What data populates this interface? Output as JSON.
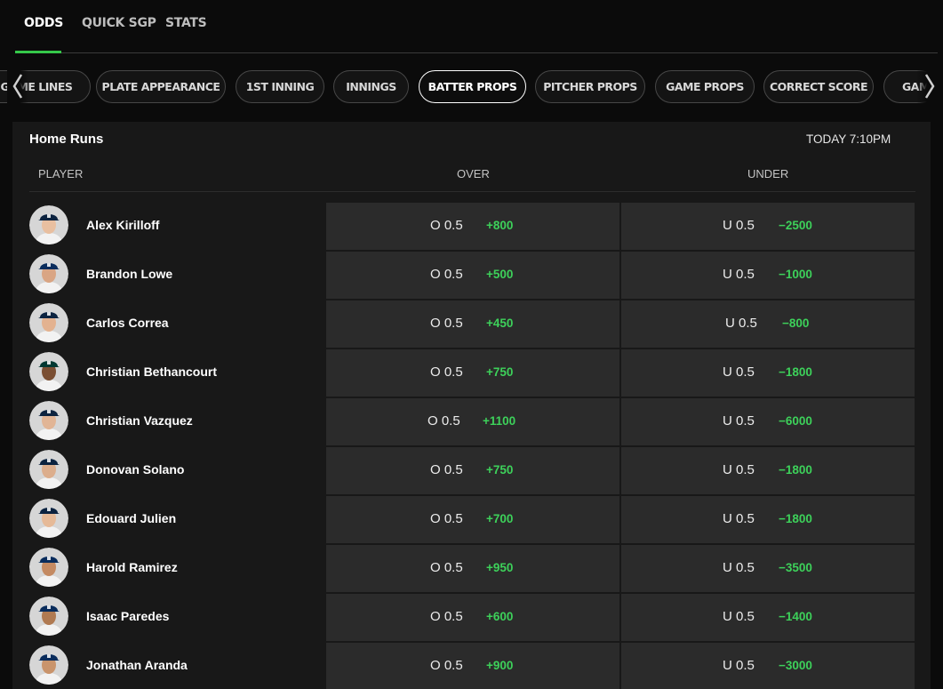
{
  "top_tabs": [
    {
      "label": "ODDS",
      "active": true
    },
    {
      "label": "QUICK SGP",
      "active": false
    },
    {
      "label": "STATS",
      "active": false
    }
  ],
  "categories": [
    {
      "label": "GAME LINES",
      "active": false
    },
    {
      "label": "PLATE APPEARANCE",
      "active": false
    },
    {
      "label": "1ST INNING",
      "active": false
    },
    {
      "label": "INNINGS",
      "active": false
    },
    {
      "label": "BATTER PROPS",
      "active": true
    },
    {
      "label": "PITCHER PROPS",
      "active": false
    },
    {
      "label": "GAME PROPS",
      "active": false
    },
    {
      "label": "CORRECT SCORE",
      "active": false
    },
    {
      "label": "GAM",
      "active": false
    }
  ],
  "nav_icons": {
    "prev": "chevron-left-icon",
    "next": "chevron-right-icon"
  },
  "market": {
    "title": "Home Runs",
    "time": "TODAY 7:10PM",
    "columns": {
      "player": "PLAYER",
      "over": "OVER",
      "under": "UNDER"
    }
  },
  "colors": {
    "accent": "#35c84a",
    "odds_green": "#3dd15a",
    "background": "#0b0b0b",
    "panel": "#181818",
    "cell": "#2b2b2b",
    "twins_cap": "#0c2340",
    "rays_cap": "#092c5c",
    "athletics_cap": "#003831"
  },
  "rows": [
    {
      "player": "Alex Kirilloff",
      "team": "twins",
      "over_line": "O 0.5",
      "over_price": "+800",
      "under_line": "U 0.5",
      "under_price": "−2500"
    },
    {
      "player": "Brandon Lowe",
      "team": "rays",
      "over_line": "O 0.5",
      "over_price": "+500",
      "under_line": "U 0.5",
      "under_price": "−1000"
    },
    {
      "player": "Carlos Correa",
      "team": "twins",
      "over_line": "O 0.5",
      "over_price": "+450",
      "under_line": "U 0.5",
      "under_price": "−800"
    },
    {
      "player": "Christian Bethancourt",
      "team": "athletics",
      "over_line": "O 0.5",
      "over_price": "+750",
      "under_line": "U 0.5",
      "under_price": "−1800"
    },
    {
      "player": "Christian Vazquez",
      "team": "twins",
      "over_line": "O 0.5",
      "over_price": "+1100",
      "under_line": "U 0.5",
      "under_price": "−6000"
    },
    {
      "player": "Donovan Solano",
      "team": "twins",
      "over_line": "O 0.5",
      "over_price": "+750",
      "under_line": "U 0.5",
      "under_price": "−1800"
    },
    {
      "player": "Edouard Julien",
      "team": "twins",
      "over_line": "O 0.5",
      "over_price": "+700",
      "under_line": "U 0.5",
      "under_price": "−1800"
    },
    {
      "player": "Harold Ramirez",
      "team": "rays",
      "over_line": "O 0.5",
      "over_price": "+950",
      "under_line": "U 0.5",
      "under_price": "−3500"
    },
    {
      "player": "Isaac Paredes",
      "team": "rays",
      "over_line": "O 0.5",
      "over_price": "+600",
      "under_line": "U 0.5",
      "under_price": "−1400"
    },
    {
      "player": "Jonathan Aranda",
      "team": "rays",
      "over_line": "O 0.5",
      "over_price": "+900",
      "under_line": "U 0.5",
      "under_price": "−3000"
    }
  ]
}
